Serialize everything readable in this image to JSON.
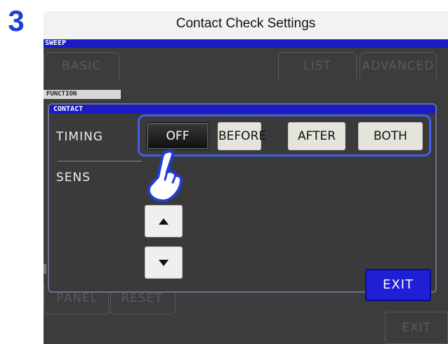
{
  "step_number": "3",
  "caption": "Contact Check Settings",
  "background": {
    "sweep_label": "SWEEP",
    "tabs": [
      {
        "label": "BASIC"
      },
      {
        "label": "LIST"
      },
      {
        "label": "ADVANCED"
      }
    ],
    "function_label": "FUNCTION",
    "panel_label": "PANEL",
    "reset_label": "RESET",
    "exit_label": "EXIT"
  },
  "dialog": {
    "title": "CONTACT",
    "timing_label": "TIMING",
    "sens_label": "SENS",
    "timing_options": [
      {
        "label": "OFF",
        "selected": true
      },
      {
        "label": "BEFORE",
        "selected": false
      },
      {
        "label": "AFTER",
        "selected": false
      },
      {
        "label": "BOTH",
        "selected": false
      }
    ],
    "exit_label": "EXIT"
  },
  "icons": {
    "pointer": "pointing-hand-icon",
    "up": "up-arrow-icon",
    "down": "down-arrow-icon"
  },
  "colors": {
    "step_number": "#1f3fd4",
    "title_bar": "#1c1cc4",
    "highlight": "#3f60e8",
    "exit_button": "#1f1fd6"
  }
}
